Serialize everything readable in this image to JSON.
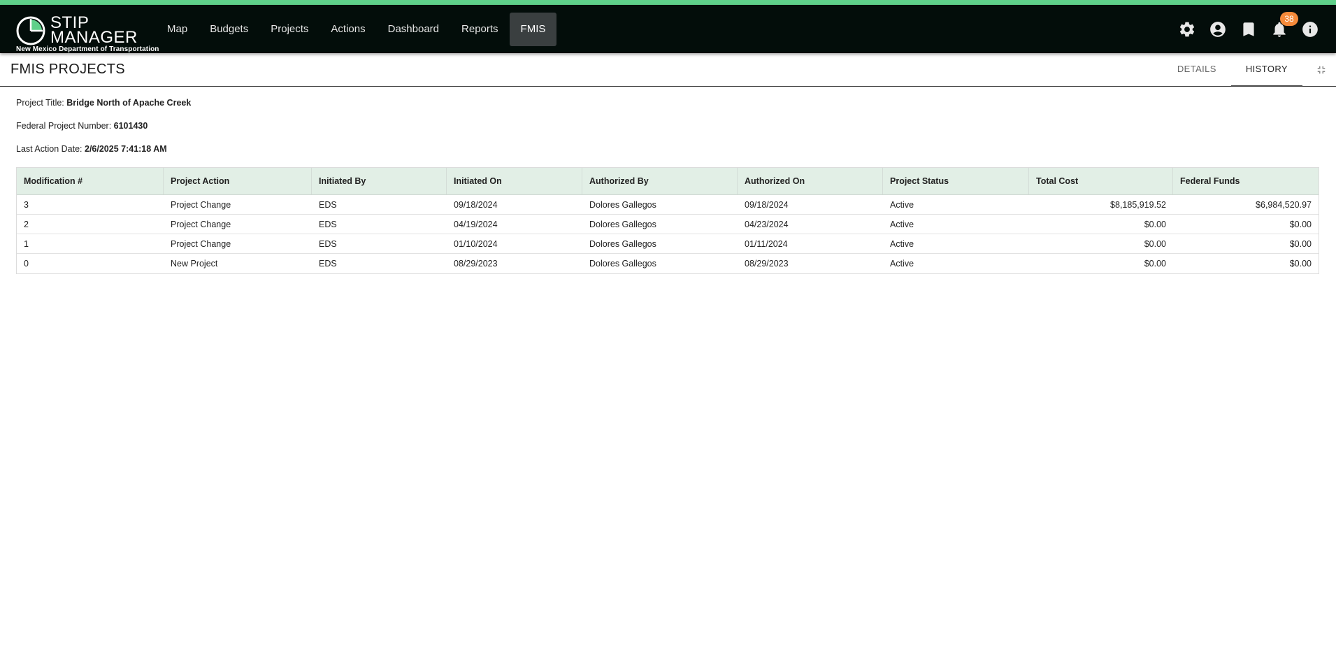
{
  "app": {
    "logo_line1": "STIP",
    "logo_line2": "MANAGER",
    "logo_subtitle": "New Mexico Department of Transportation",
    "brand_color": "#5fd08a",
    "navbar_color": "#030d0a"
  },
  "nav": {
    "items": [
      {
        "label": "Map"
      },
      {
        "label": "Budgets"
      },
      {
        "label": "Projects"
      },
      {
        "label": "Actions"
      },
      {
        "label": "Dashboard"
      },
      {
        "label": "Reports"
      },
      {
        "label": "FMIS",
        "active": true
      }
    ],
    "icons": [
      "gear-icon",
      "account-circle-icon",
      "bookmark-icon",
      "bell-icon",
      "info-icon"
    ],
    "notification_count": "38"
  },
  "page": {
    "title": "FMIS PROJECTS",
    "tabs": [
      {
        "label": "DETAILS"
      },
      {
        "label": "HISTORY",
        "active": true
      }
    ]
  },
  "project": {
    "title_label": "Project Title:",
    "title_value": "Bridge North of Apache Creek",
    "number_label": "Federal Project Number:",
    "number_value": "6101430",
    "date_label": "Last Action Date:",
    "date_value": "2/6/2025 7:41:18 AM"
  },
  "history": {
    "columns": [
      "Modification #",
      "Project Action",
      "Initiated By",
      "Initiated On",
      "Authorized By",
      "Authorized On",
      "Project Status",
      "Total Cost",
      "Federal Funds"
    ],
    "rows": [
      [
        "3",
        "Project Change",
        "EDS",
        "09/18/2024",
        "Dolores Gallegos",
        "09/18/2024",
        "Active",
        "$8,185,919.52",
        "$6,984,520.97"
      ],
      [
        "2",
        "Project Change",
        "EDS",
        "04/19/2024",
        "Dolores Gallegos",
        "04/23/2024",
        "Active",
        "$0.00",
        "$0.00"
      ],
      [
        "1",
        "Project Change",
        "EDS",
        "01/10/2024",
        "Dolores Gallegos",
        "01/11/2024",
        "Active",
        "$0.00",
        "$0.00"
      ],
      [
        "0",
        "New Project",
        "EDS",
        "08/29/2023",
        "Dolores Gallegos",
        "08/29/2023",
        "Active",
        "$0.00",
        "$0.00"
      ]
    ]
  }
}
